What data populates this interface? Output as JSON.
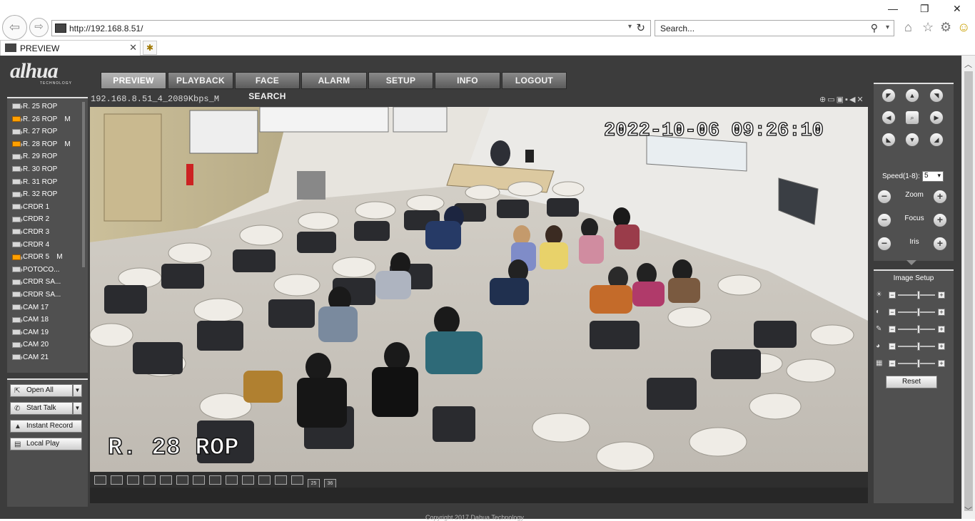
{
  "browser": {
    "url": "http://192.168.8.51/",
    "search_placeholder": "Search...",
    "tab_title": "PREVIEW",
    "back_glyph": "⇦",
    "forward_glyph": "⇨",
    "refresh_glyph": "↻",
    "dropdown_glyph": "▾",
    "tab_close_glyph": "✕",
    "new_tab_glyph": "✱",
    "toolbar_icons": [
      "home-icon",
      "favorites-star-icon",
      "settings-gear-icon",
      "smiley-feedback-icon"
    ],
    "toolbar_glyphs": [
      "⌂",
      "☆",
      "⚙",
      "☺"
    ],
    "window_controls": [
      "—",
      "❐",
      "✕"
    ]
  },
  "app": {
    "logo": "alhua",
    "logo_sub": "TECHNOLOGY",
    "nav_tabs": [
      "PREVIEW",
      "PLAYBACK",
      "FACE SEARCH",
      "ALARM",
      "SETUP",
      "INFO",
      "LOGOUT"
    ],
    "active_tab": "PREVIEW",
    "channels": [
      {
        "label": "R. 25 ROP",
        "active": false,
        "mark": ""
      },
      {
        "label": "R. 26 ROP",
        "active": true,
        "mark": "M"
      },
      {
        "label": "R. 27 ROP",
        "active": false,
        "mark": ""
      },
      {
        "label": "R. 28 ROP",
        "active": true,
        "mark": "M"
      },
      {
        "label": "R. 29 ROP",
        "active": false,
        "mark": ""
      },
      {
        "label": "R. 30 ROP",
        "active": false,
        "mark": ""
      },
      {
        "label": "R. 31 ROP",
        "active": false,
        "mark": ""
      },
      {
        "label": "R. 32 ROP",
        "active": false,
        "mark": ""
      },
      {
        "label": "CRDR 1",
        "active": false,
        "mark": ""
      },
      {
        "label": "CRDR 2",
        "active": false,
        "mark": ""
      },
      {
        "label": "CRDR 3",
        "active": false,
        "mark": ""
      },
      {
        "label": "CRDR 4",
        "active": false,
        "mark": ""
      },
      {
        "label": "CRDR 5",
        "active": true,
        "mark": "M"
      },
      {
        "label": "POTOCO...",
        "active": false,
        "mark": ""
      },
      {
        "label": "CRDR SA...",
        "active": false,
        "mark": ""
      },
      {
        "label": "CRDR SA...",
        "active": false,
        "mark": ""
      },
      {
        "label": "CAM 17",
        "active": false,
        "mark": ""
      },
      {
        "label": "CAM 18",
        "active": false,
        "mark": ""
      },
      {
        "label": "CAM 19",
        "active": false,
        "mark": ""
      },
      {
        "label": "CAM 20",
        "active": false,
        "mark": ""
      },
      {
        "label": "CAM 21",
        "active": false,
        "mark": ""
      }
    ],
    "actions": {
      "open_all": "Open All",
      "start_talk": "Start Talk",
      "instant_record": "Instant Record",
      "local_play": "Local Play"
    },
    "video": {
      "stream_info": "192.168.8.51_4_2089Kbps_M",
      "osd_timestamp": "2022-10-06 09:26:10",
      "osd_channel": "R. 28 ROP",
      "layout_buttons": [
        "",
        "",
        "",
        "",
        "",
        "",
        "",
        "",
        "",
        "",
        "",
        "",
        "",
        "25",
        "36"
      ]
    },
    "ptz": {
      "speed_label": "Speed(1-8):",
      "speed_value": "5",
      "zoom_label": "Zoom",
      "focus_label": "Focus",
      "iris_label": "Iris"
    },
    "image_setup": {
      "title": "Image Setup",
      "sliders": [
        {
          "icon": "brightness-icon",
          "level": 0.55
        },
        {
          "icon": "contrast-icon",
          "level": 0.55
        },
        {
          "icon": "saturation-icon",
          "level": 0.55
        },
        {
          "icon": "hue-icon",
          "level": 0.55
        },
        {
          "icon": "gain-icon",
          "level": 0.55
        }
      ],
      "reset_label": "Reset"
    },
    "copyright": "Copyright 2017 Dahua Technology"
  },
  "colors": {
    "app_bg": "#3c3c3c",
    "panel_bg": "#505050",
    "channel_active": "#ffa000"
  }
}
